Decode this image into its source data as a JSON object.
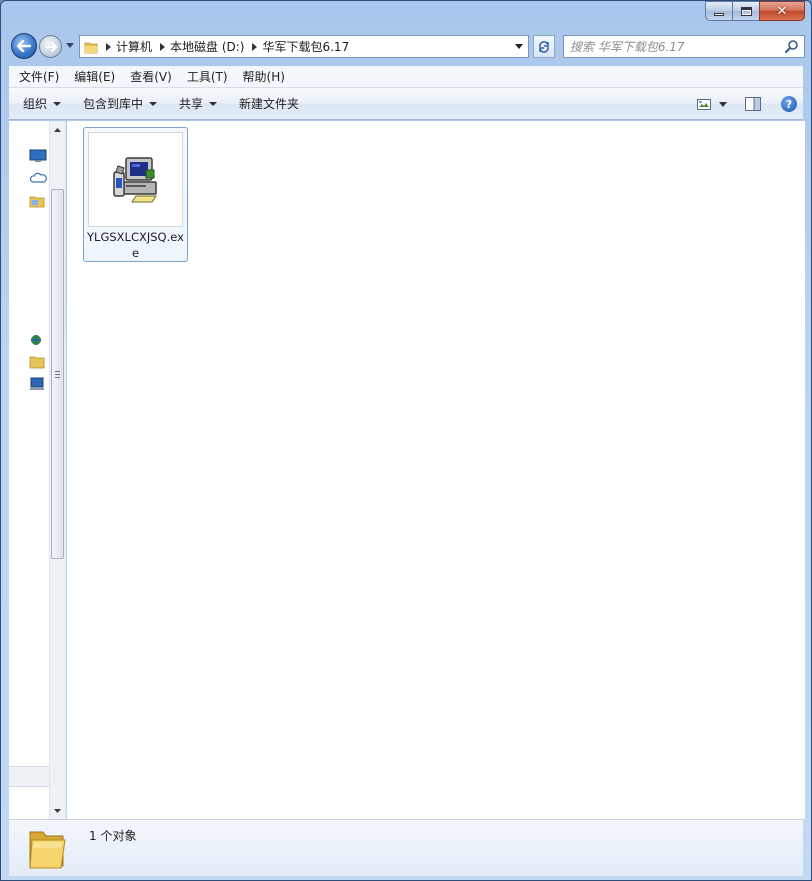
{
  "window": {
    "minimize_icon": "minimize-icon",
    "maximize_icon": "maximize-icon",
    "close_glyph": "✕"
  },
  "address": {
    "crumbs": [
      "计算机",
      "本地磁盘 (D:)",
      "华军下载包6.17"
    ]
  },
  "search": {
    "placeholder": "搜索 华军下载包6.17"
  },
  "menu": {
    "items": [
      "文件(F)",
      "编辑(E)",
      "查看(V)",
      "工具(T)",
      "帮助(H)"
    ]
  },
  "toolbar": {
    "organize": "组织",
    "include_in_library": "包含到库中",
    "share": "共享",
    "new_folder": "新建文件夹",
    "help_glyph": "?"
  },
  "files": [
    {
      "name": "YLGSXLCXJSQ.exe",
      "icon": "installer-exe-icon"
    }
  ],
  "details": {
    "count_text": "1 个对象"
  },
  "colors": {
    "accent": "#3b78cc",
    "selection_border": "#7da2ce",
    "frame": "#a9c6ec"
  }
}
